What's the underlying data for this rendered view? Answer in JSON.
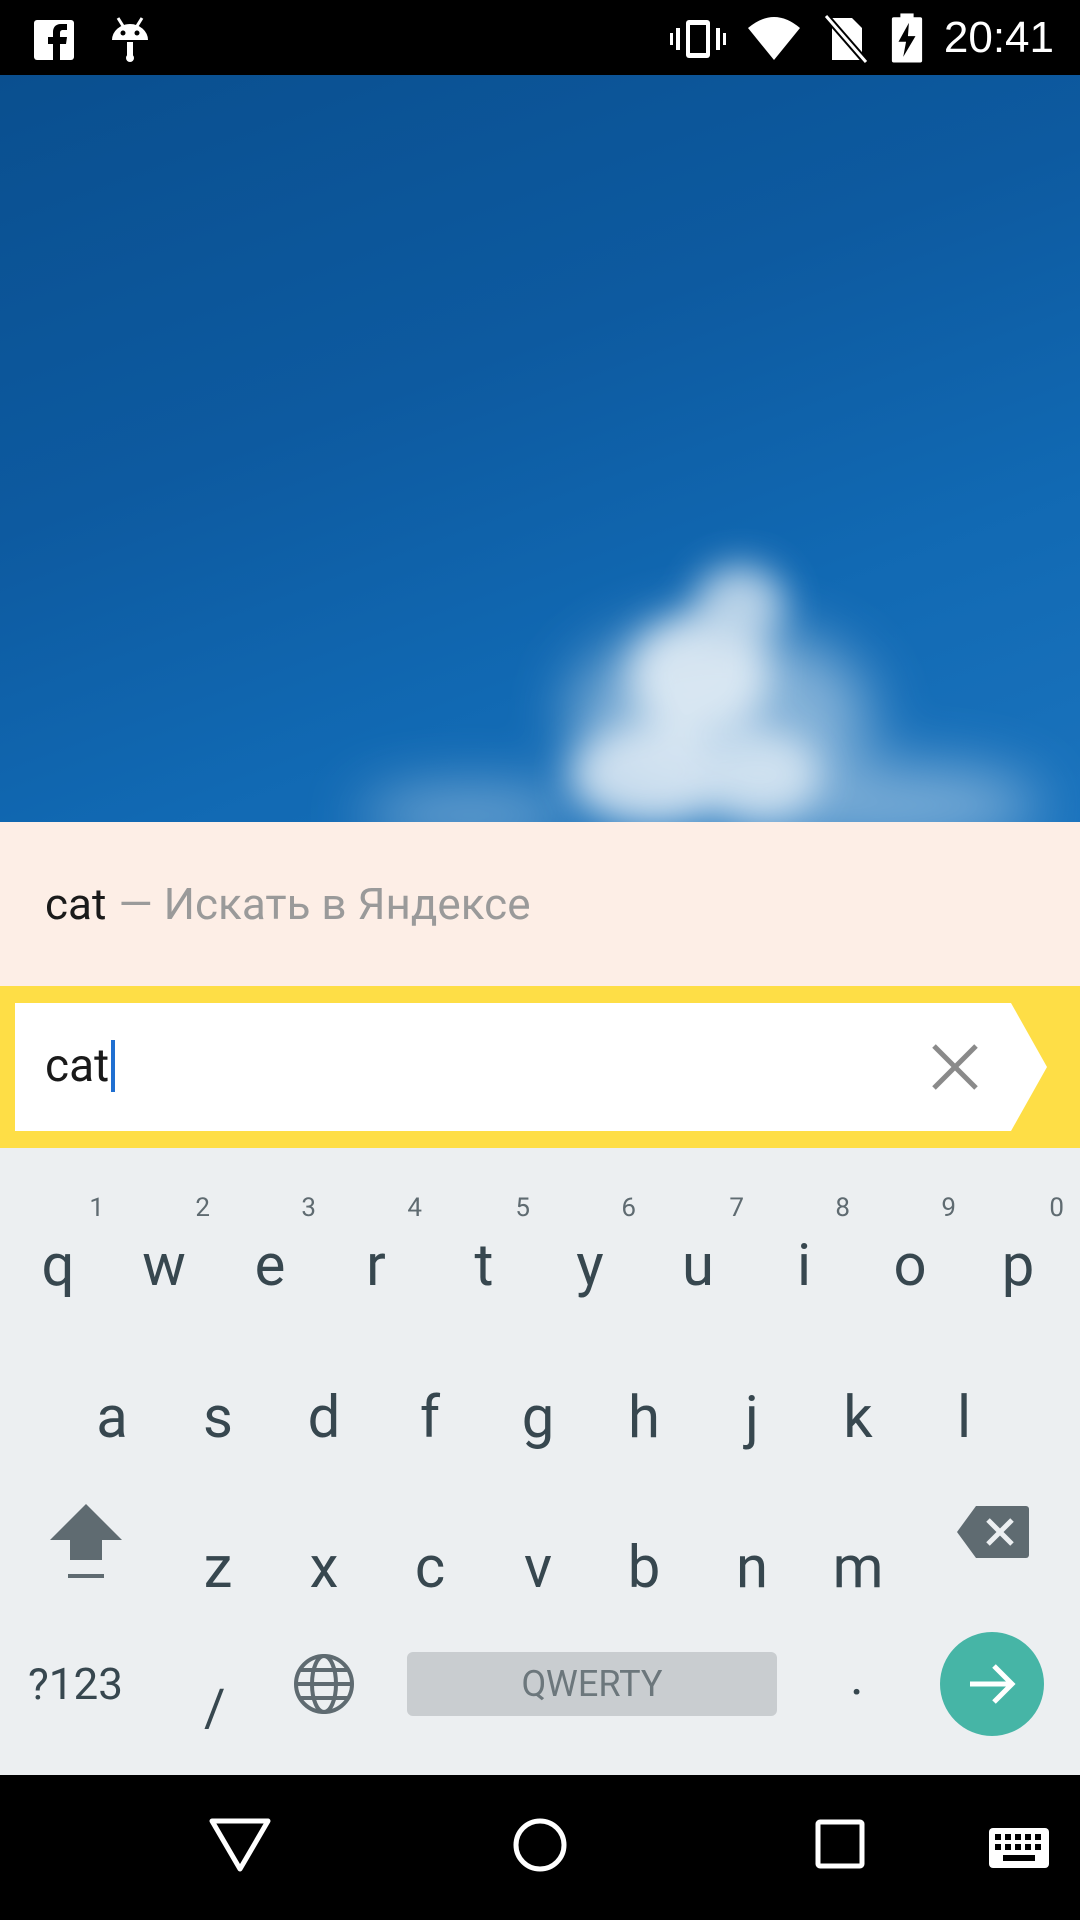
{
  "status_bar": {
    "time": "20:41",
    "left_icons": [
      "facebook-icon",
      "android-debug-icon"
    ],
    "right_icons": [
      "vibrate-icon",
      "wifi-icon",
      "no-sim-icon",
      "battery-charging-icon"
    ]
  },
  "suggestion": {
    "query": "cat",
    "hint": "— Искать в Яндексе"
  },
  "search": {
    "value": "cat",
    "clear_icon": "close-icon",
    "submit_icon": "arrow-right-icon",
    "colors": {
      "bar": "#fede46",
      "suggestion_bg": "#fdeee6",
      "caret": "#1f6fd1"
    }
  },
  "keyboard": {
    "row1": [
      {
        "label": "q",
        "hint": "1"
      },
      {
        "label": "w",
        "hint": "2"
      },
      {
        "label": "e",
        "hint": "3"
      },
      {
        "label": "r",
        "hint": "4"
      },
      {
        "label": "t",
        "hint": "5"
      },
      {
        "label": "y",
        "hint": "6"
      },
      {
        "label": "u",
        "hint": "7"
      },
      {
        "label": "i",
        "hint": "8"
      },
      {
        "label": "o",
        "hint": "9"
      },
      {
        "label": "p",
        "hint": "0"
      }
    ],
    "row2": [
      "a",
      "s",
      "d",
      "f",
      "g",
      "h",
      "j",
      "k",
      "l"
    ],
    "row3": [
      "z",
      "x",
      "c",
      "v",
      "b",
      "n",
      "m"
    ],
    "bottom": {
      "symbols_label": "?123",
      "slash_label": "/",
      "space_label": "QWERTY",
      "period_label": "."
    },
    "enter_color": "#46b5a6"
  },
  "nav_bar": {
    "buttons": [
      "back-icon",
      "home-icon",
      "recents-icon",
      "keyboard-switch-icon"
    ]
  }
}
